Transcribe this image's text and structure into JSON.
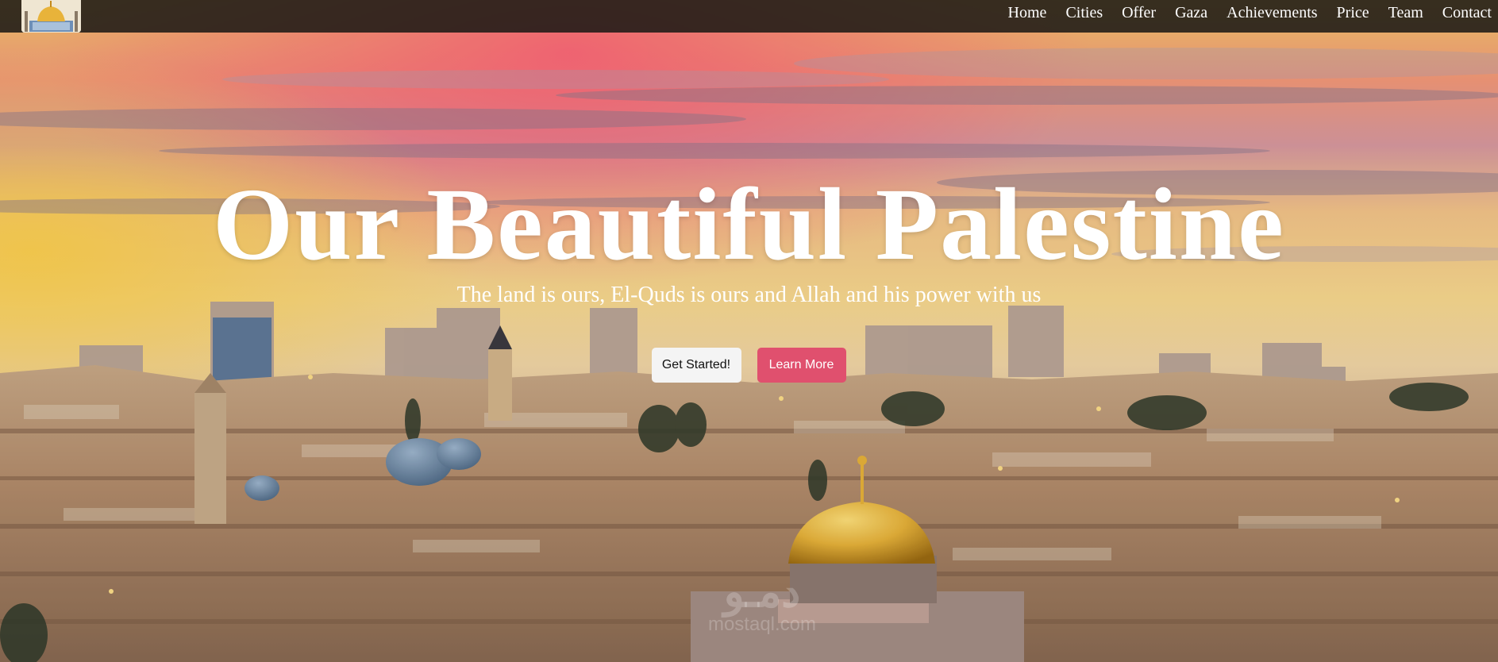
{
  "nav": {
    "items": [
      {
        "label": "Home"
      },
      {
        "label": "Cities"
      },
      {
        "label": "Offer"
      },
      {
        "label": "Gaza"
      },
      {
        "label": "Achievements"
      },
      {
        "label": "Price"
      },
      {
        "label": "Team"
      },
      {
        "label": "Contact"
      }
    ]
  },
  "hero": {
    "title": "Our Beautiful Palestine",
    "subtitle": "The land is ours, El-Quds is ours and Allah and his power with us",
    "primary_button": "Get Started!",
    "secondary_button": "Learn More"
  },
  "watermark": {
    "big": "دمـو",
    "small": "mostaql.com"
  },
  "colors": {
    "navbar_bg": "#1e1a16",
    "accent_button": "#e0506e",
    "light_button": "#f4f4f4",
    "dome_gold": "#e8b33a"
  },
  "icons": {
    "logo": "dome-of-the-rock-logo"
  }
}
